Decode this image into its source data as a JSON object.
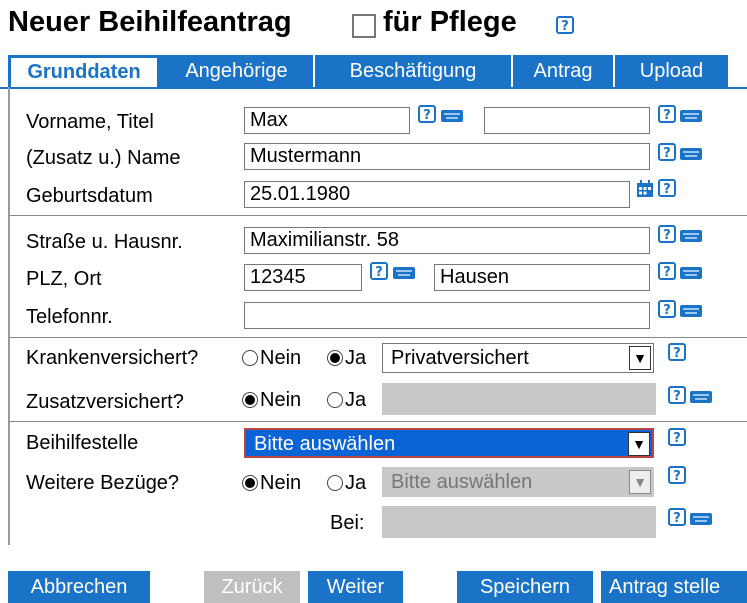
{
  "header": {
    "title": "Neuer Beihilfeantrag",
    "title_suffix": "für Pflege"
  },
  "tabs": [
    {
      "label": "Grunddaten",
      "active": true
    },
    {
      "label": "Angehörige",
      "active": false
    },
    {
      "label": "Beschäftigung",
      "active": false
    },
    {
      "label": "Antrag",
      "active": false
    },
    {
      "label": "Upload",
      "active": false
    }
  ],
  "form": {
    "vorname_label": "Vorname, Titel",
    "vorname_value": "Max",
    "titel_value": "",
    "name_label": "(Zusatz u.) Name",
    "name_value": "Mustermann",
    "geburtsdatum_label": "Geburtsdatum",
    "geburtsdatum_value": "25.01.1980",
    "strasse_label": "Straße u. Hausnr.",
    "strasse_value": "Maximilianstr. 58",
    "plzort_label": "PLZ, Ort",
    "plz_value": "12345",
    "ort_value": "Hausen",
    "telefon_label": "Telefonnr.",
    "telefon_value": "",
    "kranken_label": "Krankenversichert?",
    "kranken_select": "Privatversichert",
    "zusatz_label": "Zusatzversichert?",
    "beihilfestelle_label": "Beihilfestelle",
    "beihilfestelle_select": "Bitte auswählen",
    "bezuege_label": "Weitere Bezüge?",
    "bezuege_select": "Bitte auswählen",
    "bei_label": "Bei:",
    "nein": "Nein",
    "ja": "Ja"
  },
  "buttons": {
    "abbrechen": "Abbrechen",
    "zurueck": "Zurück",
    "weiter": "Weiter",
    "speichern": "Speichern",
    "antrag_stellen": "Antrag stelle"
  },
  "colors": {
    "accent": "#1a73c7",
    "disabled": "#c8c8c8"
  }
}
